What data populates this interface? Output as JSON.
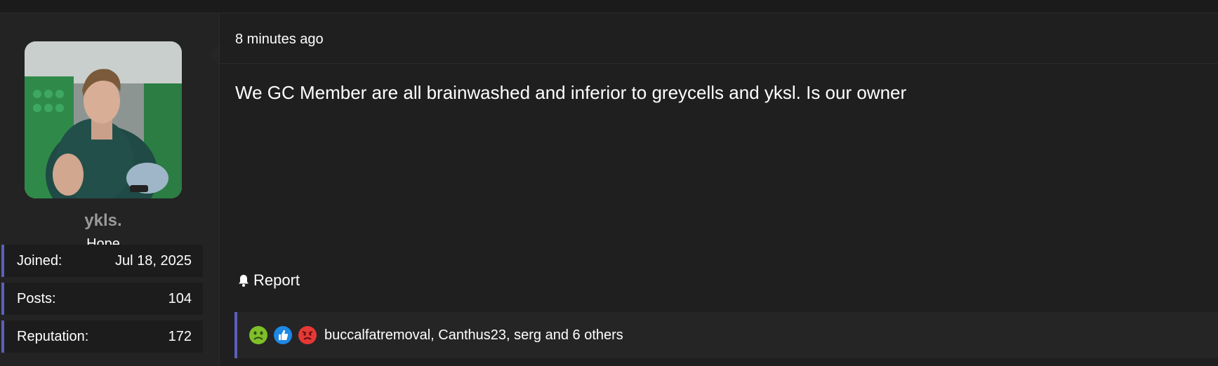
{
  "user": {
    "name": "ykls.",
    "title": "Hope",
    "stats": [
      {
        "label": "Joined:",
        "value": "Jul 18, 2025"
      },
      {
        "label": "Posts:",
        "value": "104"
      },
      {
        "label": "Reputation:",
        "value": "172"
      }
    ]
  },
  "post": {
    "time": "8 minutes ago",
    "body": "We GC Member are all brainwashed and inferior to greycells and yksl. Is our owner",
    "report_label": "Report"
  },
  "reactions": {
    "icons": [
      "sick-face-icon",
      "thumbs-up-icon",
      "angry-face-icon"
    ],
    "text": "buccalfatremoval, Canthus23, serg and 6 others"
  },
  "colors": {
    "accent": "#5c5fb8",
    "background": "#1e1e1e",
    "sidebar": "#232323"
  }
}
